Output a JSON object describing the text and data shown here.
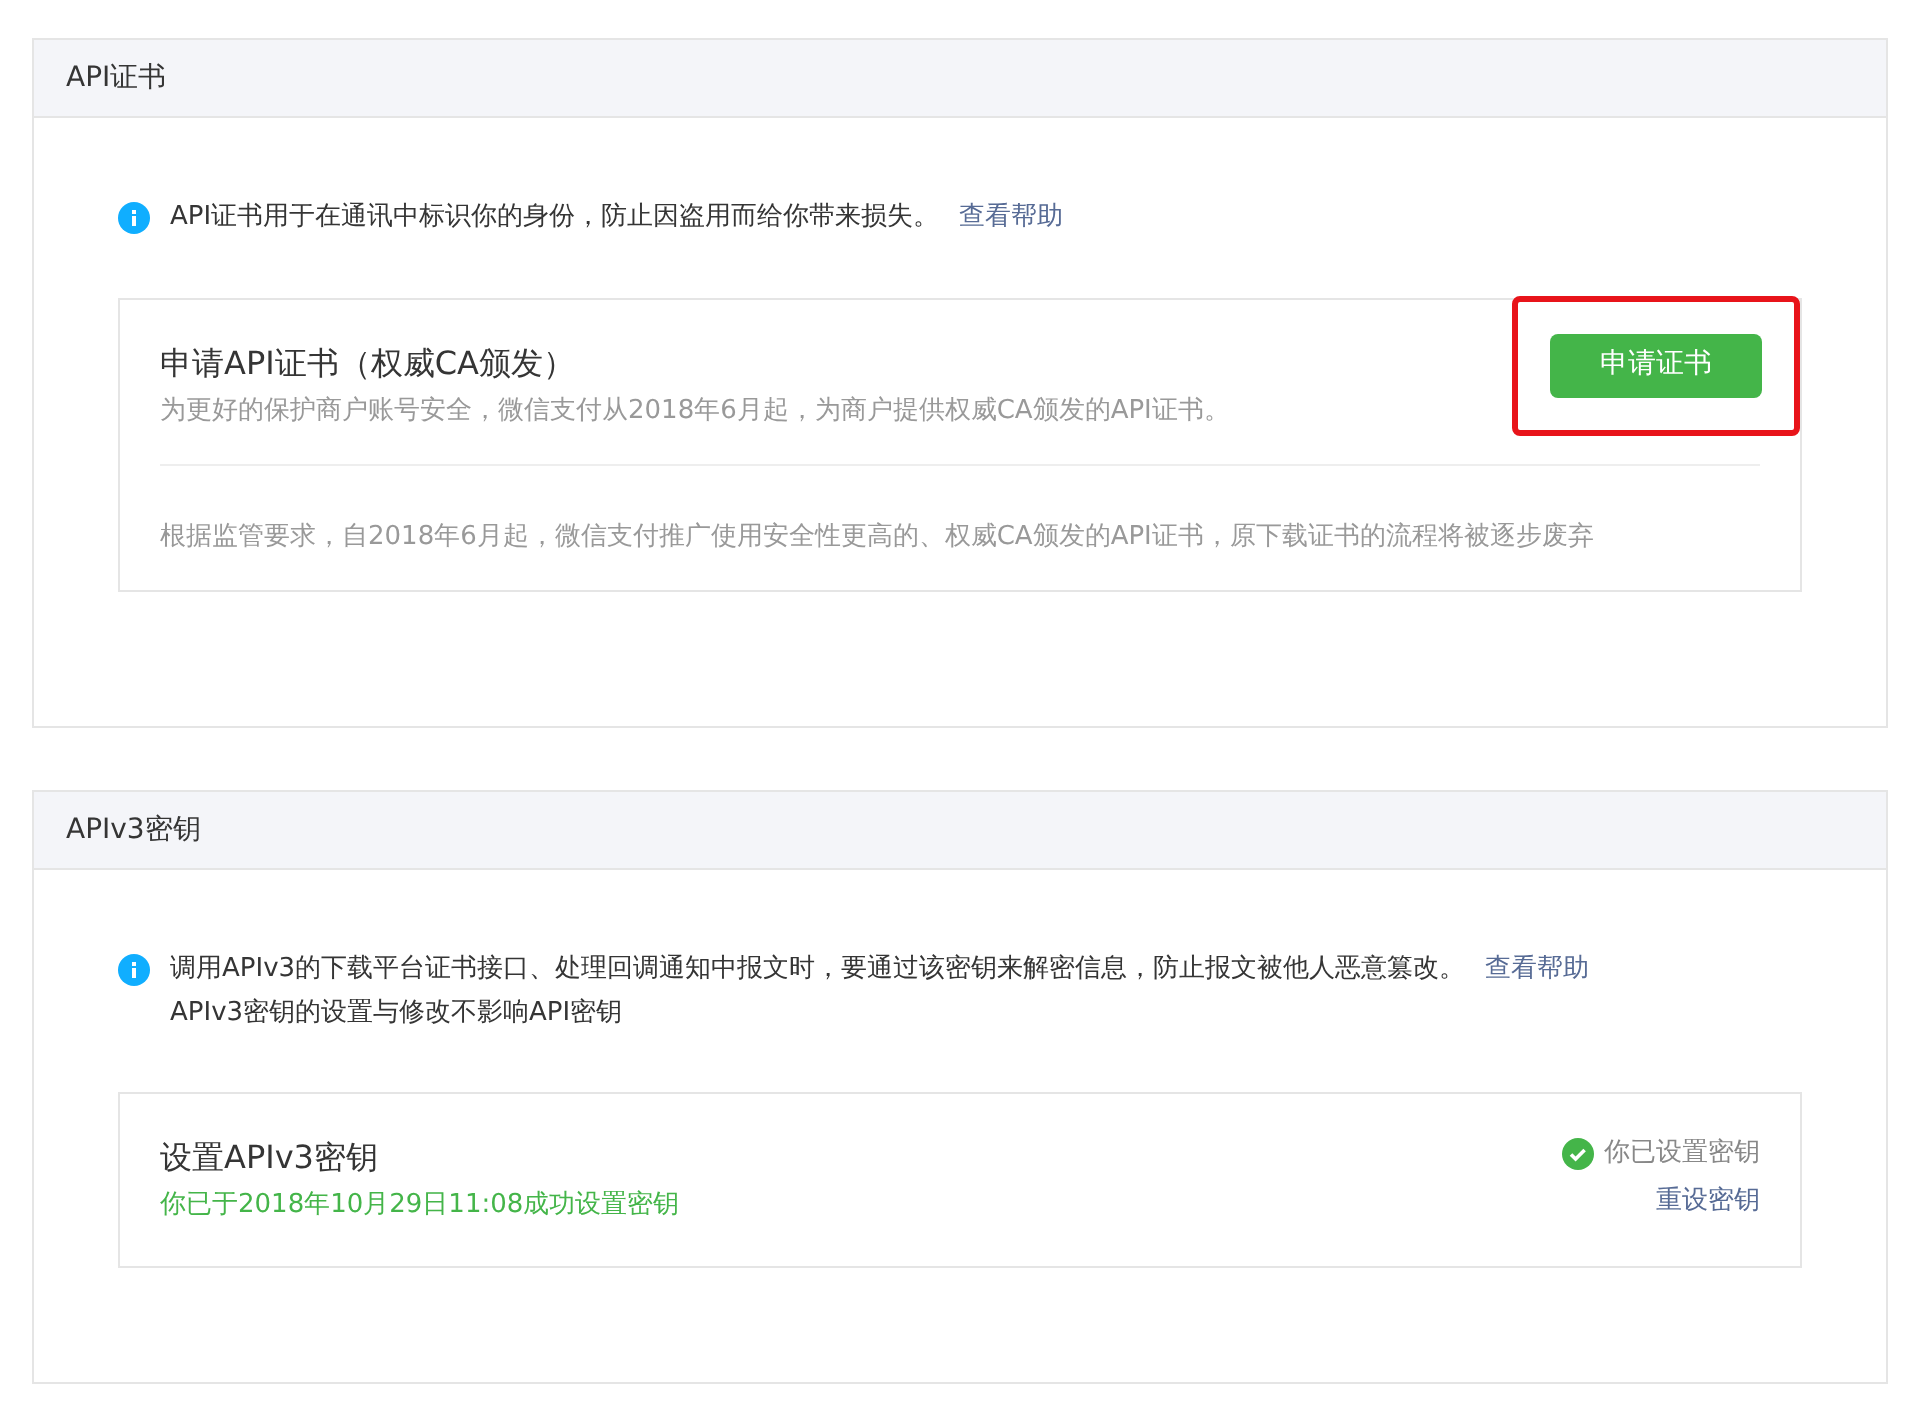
{
  "sections": [
    {
      "title": "API证书",
      "notice": {
        "text": "API证书用于在通讯中标识你的身份，防止因盗用而给你带来损失。",
        "link": "查看帮助"
      },
      "card": {
        "kind": "apply",
        "title": "申请API证书（权威CA颁发）",
        "description": "为更好的保护商户账号安全，微信支付从2018年6月起，为商户提供权威CA颁发的API证书。",
        "button": {
          "label": "申请证书",
          "highlighted": true
        },
        "footnote": "根据监管要求，自2018年6月起，微信支付推广使用安全性更高的、权威CA颁发的API证书，原下载证书的流程将被逐步废弃"
      }
    },
    {
      "title": "APIv3密钥",
      "notice": {
        "text": "调用APIv3的下载平台证书接口、处理回调通知中报文时，要通过该密钥来解密信息，防止报文被他人恶意篡改。",
        "link": "查看帮助",
        "note": "APIv3密钥的设置与修改不影响API密钥"
      },
      "card": {
        "kind": "status",
        "title": "设置APIv3密钥",
        "detail": "你已于2018年10月29日11:08成功设置密钥",
        "status": {
          "text": "你已设置密钥",
          "done": true
        },
        "link": "重设密钥"
      }
    }
  ]
}
